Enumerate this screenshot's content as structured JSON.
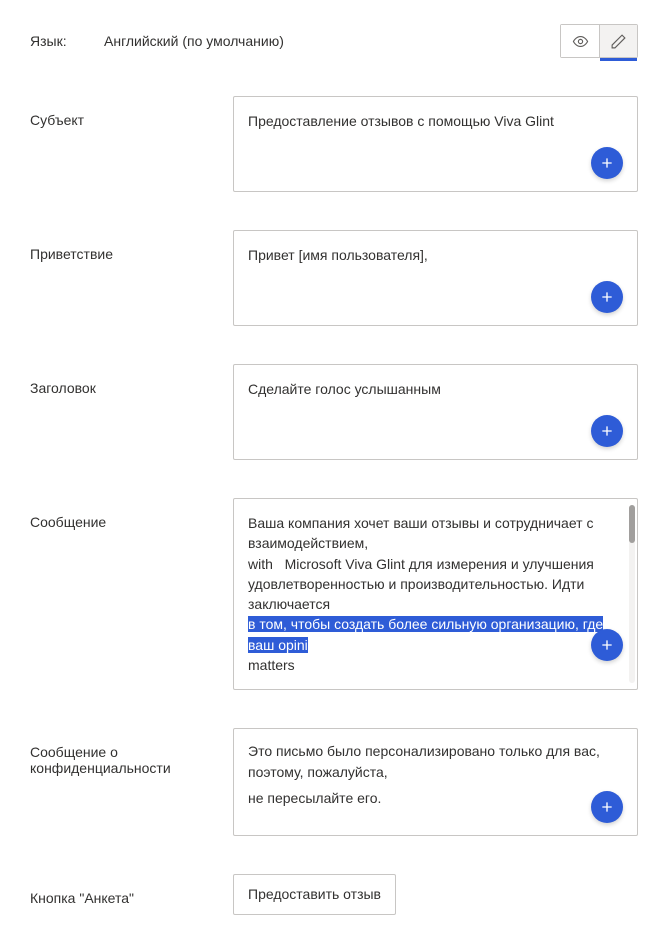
{
  "language": {
    "label": "Язык:",
    "value": "Английский (по умолчанию)"
  },
  "modes": {
    "preview": "preview",
    "edit": "edit"
  },
  "fields": {
    "subject": {
      "label": "Субъект",
      "value": "Предоставление отзывов с помощью Viva Glint"
    },
    "greeting": {
      "label": "Приветствие",
      "value": "Привет [имя пользователя],"
    },
    "headline": {
      "label": "Заголовок",
      "value": "Сделайте голос услышанным"
    },
    "message": {
      "label": "Сообщение",
      "line1a": "Ваша компания хочет ваши отзывы и сотрудничает с взаимодействием,",
      "line1b": "with",
      "line1c": "Microsoft Viva Glint для измерения и улучшения",
      "line2": "удовлетворенностью и производительностью. Идти заключается",
      "line3_hl": "в том, чтобы создать более сильную организацию, где ваш opini",
      "line4": "matters"
    },
    "privacy": {
      "label": "Сообщение о конфиденциальности",
      "line1": "Это письмо было персонализировано только для вас, поэтому, пожалуйста,",
      "line2": "не пересылайте его."
    },
    "survey_button": {
      "label": "Кнопка \"Анкета\"",
      "value": "Предоставить отзыв"
    }
  }
}
